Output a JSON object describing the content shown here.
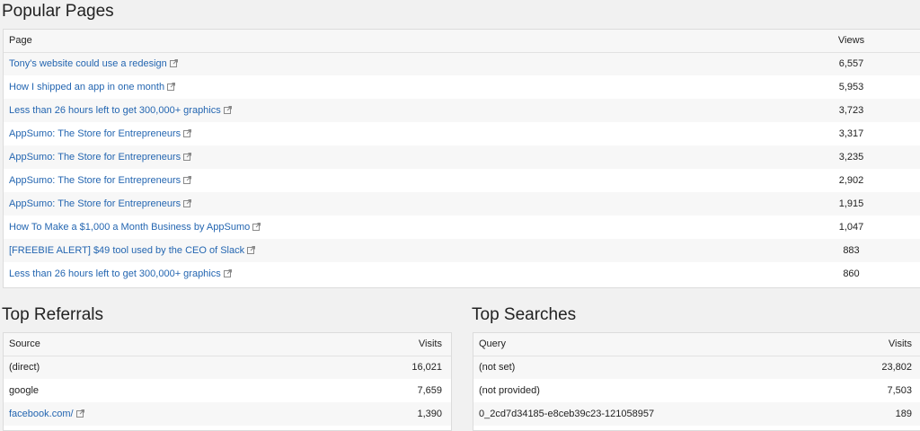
{
  "popular_pages": {
    "title": "Popular Pages",
    "columns": {
      "page": "Page",
      "views": "Views"
    },
    "rows": [
      {
        "page": "Tony's website could use a redesign",
        "views": "6,557"
      },
      {
        "page": "How I shipped an app in one month",
        "views": "5,953"
      },
      {
        "page": "Less than 26 hours left to get 300,000+ graphics",
        "views": "3,723"
      },
      {
        "page": "AppSumo: The Store for Entrepreneurs",
        "views": "3,317"
      },
      {
        "page": "AppSumo: The Store for Entrepreneurs",
        "views": "3,235"
      },
      {
        "page": "AppSumo: The Store for Entrepreneurs",
        "views": "2,902"
      },
      {
        "page": "AppSumo: The Store for Entrepreneurs",
        "views": "1,915"
      },
      {
        "page": "How To Make a $1,000 a Month Business by AppSumo",
        "views": "1,047"
      },
      {
        "page": "[FREEBIE ALERT] $49 tool used by the CEO of Slack",
        "views": "883"
      },
      {
        "page": "Less than 26 hours left to get 300,000+ graphics",
        "views": "860"
      }
    ]
  },
  "top_referrals": {
    "title": "Top Referrals",
    "columns": {
      "source": "Source",
      "visits": "Visits"
    },
    "rows": [
      {
        "source": "(direct)",
        "visits": "16,021",
        "is_link": false
      },
      {
        "source": "google",
        "visits": "7,659",
        "is_link": false
      },
      {
        "source": "facebook.com/",
        "visits": "1,390",
        "is_link": true
      }
    ]
  },
  "top_searches": {
    "title": "Top Searches",
    "columns": {
      "query": "Query",
      "visits": "Visits"
    },
    "rows": [
      {
        "query": "(not set)",
        "visits": "23,802"
      },
      {
        "query": "(not provided)",
        "visits": "7,503"
      },
      {
        "query": "0_2cd7d34185-e8ceb39c23-121058957",
        "visits": "189"
      }
    ]
  },
  "colors": {
    "link": "#2466b1",
    "background": "#f1f1f1",
    "row_alt": "#f7f7f7"
  },
  "icons": {
    "external_link": "external-link-icon"
  }
}
